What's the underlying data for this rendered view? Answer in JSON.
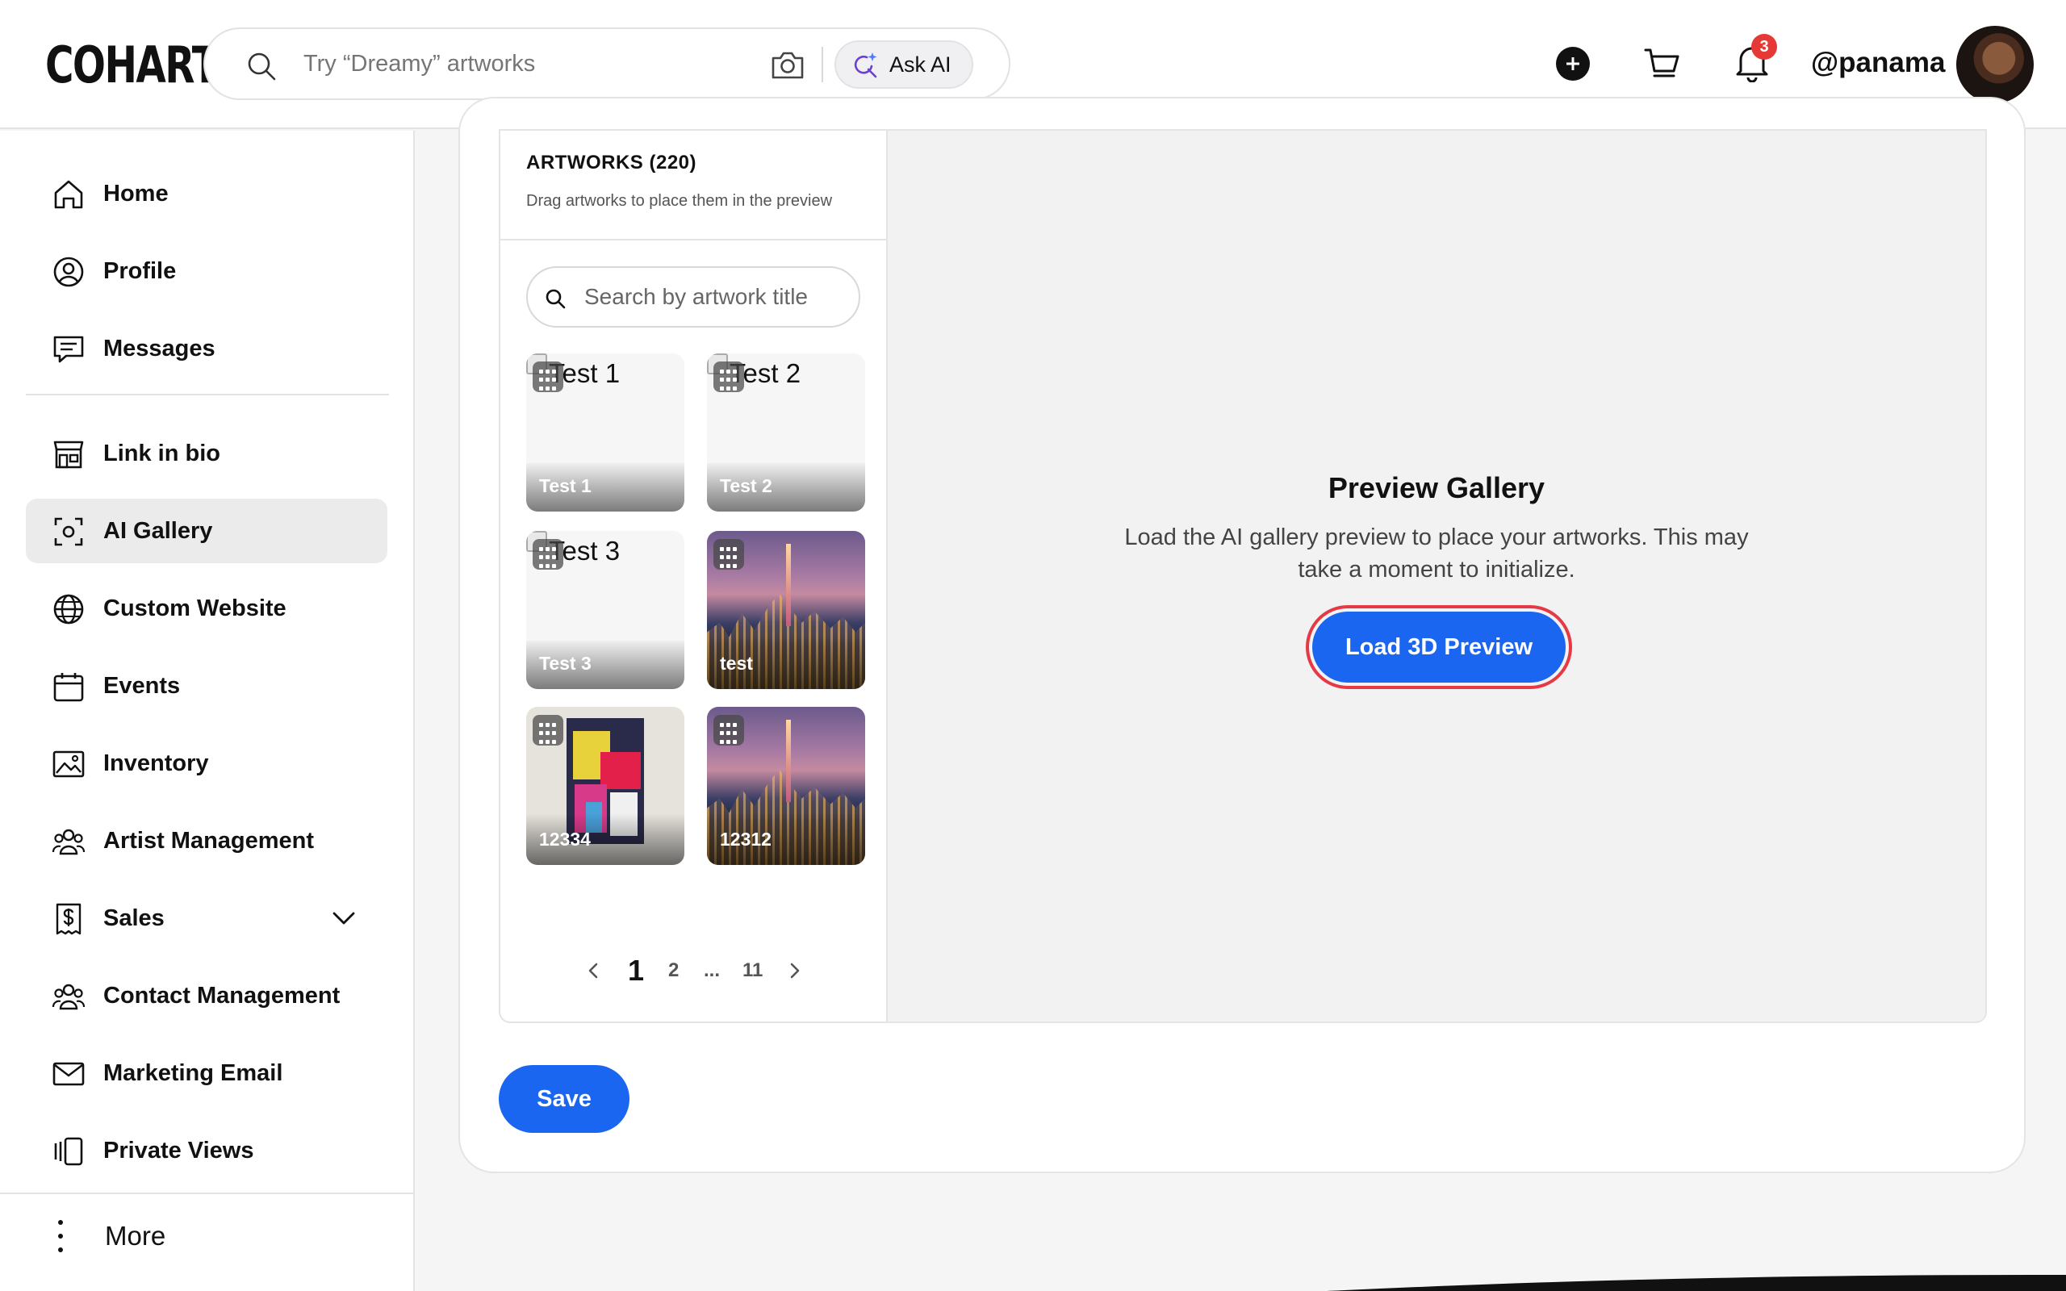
{
  "header": {
    "logo": "COHART",
    "search_placeholder": "Try “Dreamy” artworks",
    "ask_ai_label": "Ask AI",
    "notification_count": "3",
    "username": "@panama"
  },
  "sidebar": {
    "items": [
      {
        "label": "Home",
        "icon": "home-icon"
      },
      {
        "label": "Profile",
        "icon": "user-circle-icon"
      },
      {
        "label": "Messages",
        "icon": "chat-icon"
      },
      {
        "label": "Link in bio",
        "icon": "storefront-icon"
      },
      {
        "label": "AI Gallery",
        "icon": "scan-icon",
        "active": true
      },
      {
        "label": "Custom Website",
        "icon": "globe-icon"
      },
      {
        "label": "Events",
        "icon": "calendar-icon"
      },
      {
        "label": "Inventory",
        "icon": "image-icon"
      },
      {
        "label": "Artist Management",
        "icon": "users-icon"
      },
      {
        "label": "Sales",
        "icon": "receipt-dollar-icon"
      },
      {
        "label": "Contact Management",
        "icon": "users-icon"
      },
      {
        "label": "Marketing Email",
        "icon": "mail-icon"
      },
      {
        "label": "Private Views",
        "icon": "views-icon"
      }
    ],
    "more_label": "More"
  },
  "artworks": {
    "title": "ARTWORKS (220)",
    "subtitle": "Drag artworks to place them in the preview",
    "search_placeholder": "Search by artwork title",
    "items": [
      {
        "caption": "Test 1",
        "alt": "Test 1",
        "kind": "broken"
      },
      {
        "caption": "Test 2",
        "alt": "Test 2",
        "kind": "broken"
      },
      {
        "caption": "Test 3",
        "alt": "Test 3",
        "kind": "broken"
      },
      {
        "caption": "test",
        "kind": "city"
      },
      {
        "caption": "12334",
        "kind": "abstract"
      },
      {
        "caption": "12312",
        "kind": "city"
      },
      {
        "caption": "",
        "kind": "plant"
      },
      {
        "caption": "",
        "kind": "floral"
      }
    ],
    "pagination": {
      "current": "1",
      "next": "2",
      "ellipsis": "...",
      "last": "11"
    }
  },
  "preview": {
    "title": "Preview Gallery",
    "description": "Load the AI gallery preview to place your artworks. This may take a moment to initialize.",
    "button_label": "Load 3D Preview"
  },
  "save_label": "Save",
  "colors": {
    "primary": "#1a66f0",
    "badge": "#e53935",
    "active_nav": "#ebebeb"
  }
}
